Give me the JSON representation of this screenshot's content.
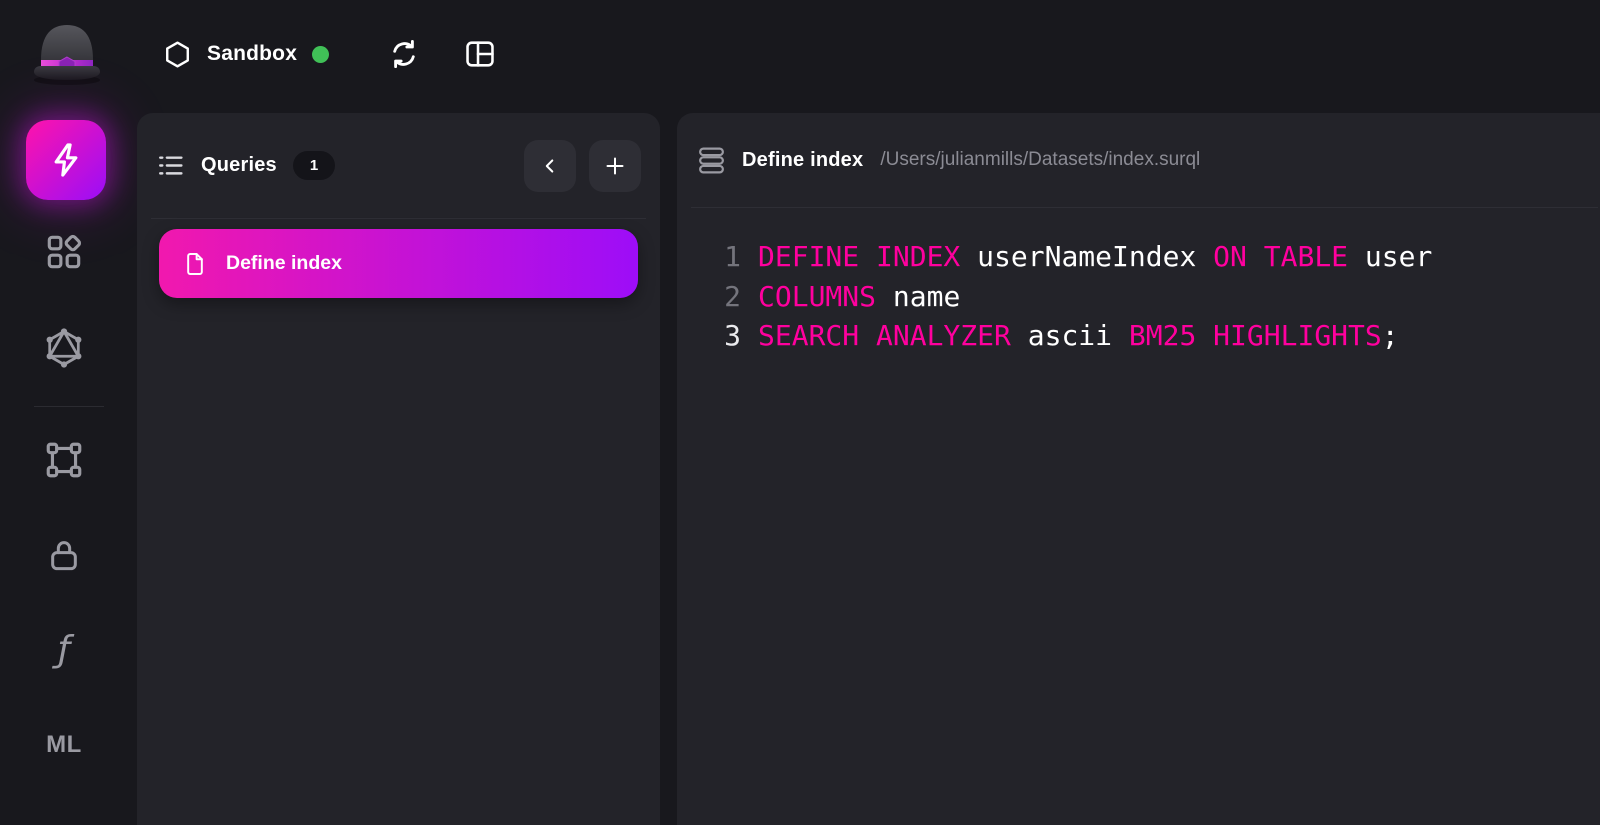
{
  "app": {
    "background": "#18181d",
    "panel_background": "#232329"
  },
  "topbar": {
    "logo": "surrealist-bowler-hat",
    "instance_name": "Sandbox",
    "status": "connected",
    "status_color": "#40c057",
    "icons": [
      "refresh-icon",
      "layout-columns-icon"
    ]
  },
  "sidebar": {
    "items": [
      {
        "id": "query",
        "icon": "lightning-icon",
        "active": true
      },
      {
        "id": "explorer",
        "icon": "category-icon",
        "active": false
      },
      {
        "id": "graphql",
        "icon": "graphql-icon",
        "active": false
      },
      {
        "id": "designer",
        "icon": "object-group-icon",
        "active": false
      },
      {
        "id": "authentication",
        "icon": "lock-icon",
        "active": false
      },
      {
        "id": "functions",
        "icon": "function-icon",
        "active": false
      },
      {
        "id": "models",
        "icon": "text",
        "label": "ML",
        "active": false
      }
    ],
    "functions_glyph": "ƒ",
    "ml_label": "ML"
  },
  "queries_panel": {
    "title": "Queries",
    "count": "1",
    "items": [
      {
        "label": "Define index",
        "active": true
      }
    ]
  },
  "editor_panel": {
    "title": "Define index",
    "path": "/Users/julianmills/Datasets/index.surql"
  },
  "code": {
    "language": "surrealql",
    "lines": [
      {
        "number": "1",
        "active": false,
        "tokens": [
          [
            "DEFINE INDEX",
            "k"
          ],
          [
            " userNameIndex ",
            "p"
          ],
          [
            "ON TABLE",
            "k"
          ],
          [
            " user",
            "p"
          ]
        ]
      },
      {
        "number": "2",
        "active": false,
        "tokens": [
          [
            "COLUMNS",
            "k"
          ],
          [
            " name",
            "p"
          ]
        ]
      },
      {
        "number": "3",
        "active": true,
        "tokens": [
          [
            "SEARCH ANALYZER",
            "k"
          ],
          [
            " ascii ",
            "p"
          ],
          [
            "BM25 HIGHLIGHTS",
            "k"
          ],
          [
            ";",
            "p"
          ]
        ]
      }
    ],
    "plain_text": "DEFINE INDEX userNameIndex ON TABLE user\nCOLUMNS name\nSEARCH ANALYZER ascii BM25 HIGHLIGHTS;"
  },
  "colors": {
    "keyword": "#ff009e",
    "plain": "#ffffff",
    "gutter": "#74747c",
    "gutter_active": "#eaeaed",
    "accent_pink": "#f118ae",
    "accent_purple": "#9d0df8",
    "status_green": "#40c057"
  }
}
